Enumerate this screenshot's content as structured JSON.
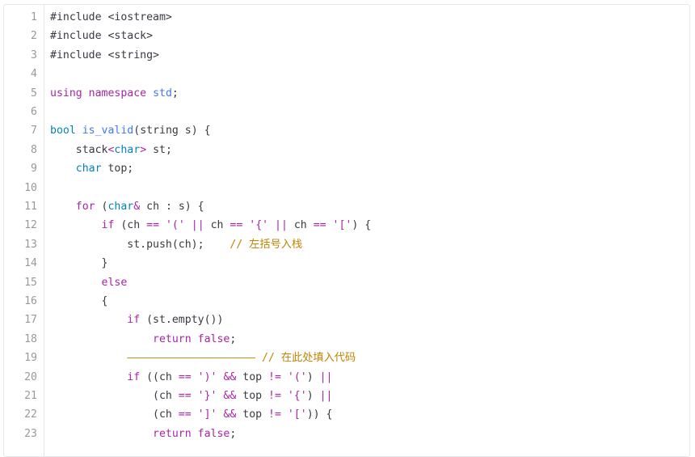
{
  "editor": {
    "colors": {
      "keyword": "#a626a4",
      "builtin_type": "#0184bb",
      "function": "#4078f2",
      "string": "#50a14f",
      "comment": "#a0a1a7",
      "line_number": "#999999",
      "plain": "#383a42"
    },
    "lines": [
      {
        "n": "1",
        "tokens": [
          {
            "t": "#include <iostream>",
            "c": "pp"
          }
        ]
      },
      {
        "n": "2",
        "tokens": [
          {
            "t": "#include <stack>",
            "c": "pp"
          }
        ]
      },
      {
        "n": "3",
        "tokens": [
          {
            "t": "#include <string>",
            "c": "pp"
          }
        ]
      },
      {
        "n": "4",
        "tokens": []
      },
      {
        "n": "5",
        "tokens": [
          {
            "t": "using",
            "c": "kw"
          },
          {
            "t": " ",
            "c": "pl"
          },
          {
            "t": "namespace",
            "c": "kw"
          },
          {
            "t": " ",
            "c": "pl"
          },
          {
            "t": "std",
            "c": "fn"
          },
          {
            "t": ";",
            "c": "pl"
          }
        ]
      },
      {
        "n": "6",
        "tokens": []
      },
      {
        "n": "7",
        "tokens": [
          {
            "t": "bool",
            "c": "st"
          },
          {
            "t": " ",
            "c": "pl"
          },
          {
            "t": "is_valid",
            "c": "fn"
          },
          {
            "t": "(string s) {",
            "c": "pl"
          }
        ]
      },
      {
        "n": "8",
        "tokens": [
          {
            "t": "    stack",
            "c": "pl"
          },
          {
            "t": "<",
            "c": "op"
          },
          {
            "t": "char",
            "c": "st"
          },
          {
            "t": ">",
            "c": "op"
          },
          {
            "t": " st;",
            "c": "pl"
          }
        ]
      },
      {
        "n": "9",
        "tokens": [
          {
            "t": "    ",
            "c": "pl"
          },
          {
            "t": "char",
            "c": "st"
          },
          {
            "t": " top;",
            "c": "pl"
          }
        ]
      },
      {
        "n": "10",
        "tokens": []
      },
      {
        "n": "11",
        "tokens": [
          {
            "t": "    ",
            "c": "pl"
          },
          {
            "t": "for",
            "c": "kw"
          },
          {
            "t": " (",
            "c": "pl"
          },
          {
            "t": "char",
            "c": "st"
          },
          {
            "t": "&",
            "c": "op"
          },
          {
            "t": " ch : s) {",
            "c": "pl"
          }
        ]
      },
      {
        "n": "12",
        "tokens": [
          {
            "t": "        ",
            "c": "pl"
          },
          {
            "t": "if",
            "c": "kw"
          },
          {
            "t": " (ch ",
            "c": "pl"
          },
          {
            "t": "==",
            "c": "op"
          },
          {
            "t": " ",
            "c": "pl"
          },
          {
            "t": "'('",
            "c": "op"
          },
          {
            "t": " ",
            "c": "pl"
          },
          {
            "t": "||",
            "c": "op"
          },
          {
            "t": " ch ",
            "c": "pl"
          },
          {
            "t": "==",
            "c": "op"
          },
          {
            "t": " ",
            "c": "pl"
          },
          {
            "t": "'{'",
            "c": "op"
          },
          {
            "t": " ",
            "c": "pl"
          },
          {
            "t": "||",
            "c": "op"
          },
          {
            "t": " ch ",
            "c": "pl"
          },
          {
            "t": "==",
            "c": "op"
          },
          {
            "t": " ",
            "c": "pl"
          },
          {
            "t": "'['",
            "c": "op"
          },
          {
            "t": ") {",
            "c": "pl"
          }
        ]
      },
      {
        "n": "13",
        "tokens": [
          {
            "t": "            st.push(ch);    ",
            "c": "pl"
          },
          {
            "t": "// 左括号入栈",
            "c": "lt"
          }
        ]
      },
      {
        "n": "14",
        "tokens": [
          {
            "t": "        }",
            "c": "pl"
          }
        ]
      },
      {
        "n": "15",
        "tokens": [
          {
            "t": "        ",
            "c": "pl"
          },
          {
            "t": "else",
            "c": "kw"
          }
        ]
      },
      {
        "n": "16",
        "tokens": [
          {
            "t": "        {",
            "c": "pl"
          }
        ]
      },
      {
        "n": "17",
        "tokens": [
          {
            "t": "            ",
            "c": "pl"
          },
          {
            "t": "if",
            "c": "kw"
          },
          {
            "t": " (st.empty())",
            "c": "pl"
          }
        ]
      },
      {
        "n": "18",
        "tokens": [
          {
            "t": "                ",
            "c": "pl"
          },
          {
            "t": "return",
            "c": "kw"
          },
          {
            "t": " ",
            "c": "pl"
          },
          {
            "t": "false",
            "c": "kw"
          },
          {
            "t": ";",
            "c": "pl"
          }
        ]
      },
      {
        "n": "19",
        "tokens": [
          {
            "t": "            ",
            "c": "pl"
          },
          {
            "t": "———————————————————— // 在此处填入代码",
            "c": "lt"
          }
        ]
      },
      {
        "n": "20",
        "tokens": [
          {
            "t": "            ",
            "c": "pl"
          },
          {
            "t": "if",
            "c": "kw"
          },
          {
            "t": " ((ch ",
            "c": "pl"
          },
          {
            "t": "==",
            "c": "op"
          },
          {
            "t": " ",
            "c": "pl"
          },
          {
            "t": "')'",
            "c": "op"
          },
          {
            "t": " ",
            "c": "pl"
          },
          {
            "t": "&&",
            "c": "op"
          },
          {
            "t": " top ",
            "c": "pl"
          },
          {
            "t": "!=",
            "c": "op"
          },
          {
            "t": " ",
            "c": "pl"
          },
          {
            "t": "'('",
            "c": "op"
          },
          {
            "t": ") ",
            "c": "pl"
          },
          {
            "t": "||",
            "c": "op"
          }
        ]
      },
      {
        "n": "21",
        "tokens": [
          {
            "t": "                (ch ",
            "c": "pl"
          },
          {
            "t": "==",
            "c": "op"
          },
          {
            "t": " ",
            "c": "pl"
          },
          {
            "t": "'}'",
            "c": "op"
          },
          {
            "t": " ",
            "c": "pl"
          },
          {
            "t": "&&",
            "c": "op"
          },
          {
            "t": " top ",
            "c": "pl"
          },
          {
            "t": "!=",
            "c": "op"
          },
          {
            "t": " ",
            "c": "pl"
          },
          {
            "t": "'{'",
            "c": "op"
          },
          {
            "t": ") ",
            "c": "pl"
          },
          {
            "t": "||",
            "c": "op"
          }
        ]
      },
      {
        "n": "22",
        "tokens": [
          {
            "t": "                (ch ",
            "c": "pl"
          },
          {
            "t": "==",
            "c": "op"
          },
          {
            "t": " ",
            "c": "pl"
          },
          {
            "t": "']'",
            "c": "op"
          },
          {
            "t": " ",
            "c": "pl"
          },
          {
            "t": "&&",
            "c": "op"
          },
          {
            "t": " top ",
            "c": "pl"
          },
          {
            "t": "!=",
            "c": "op"
          },
          {
            "t": " ",
            "c": "pl"
          },
          {
            "t": "'['",
            "c": "op"
          },
          {
            "t": ")) {",
            "c": "pl"
          }
        ]
      },
      {
        "n": "23",
        "tokens": [
          {
            "t": "                ",
            "c": "pl"
          },
          {
            "t": "return",
            "c": "kw"
          },
          {
            "t": " ",
            "c": "pl"
          },
          {
            "t": "false",
            "c": "kw"
          },
          {
            "t": ";",
            "c": "pl"
          }
        ]
      }
    ]
  }
}
